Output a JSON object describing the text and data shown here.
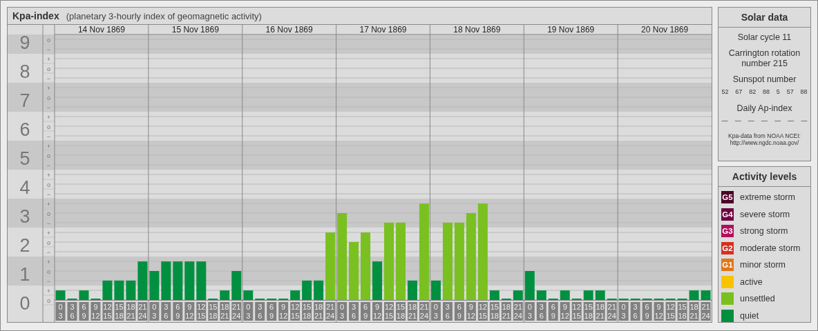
{
  "title": {
    "name": "Kpa-index",
    "subtitle": "(planetary 3-hourly index of geomagnetic activity)"
  },
  "chart": {
    "level_marks": [
      "o",
      "−",
      "+",
      "o",
      "−",
      "+",
      "o",
      "−",
      "+",
      "o",
      "−",
      "+",
      "o",
      "−",
      "+",
      "o",
      "−",
      "+",
      "o",
      "−",
      "+",
      "o",
      "−",
      "+",
      "o",
      "−",
      "+",
      "o"
    ],
    "days": [
      "14 Nov 1869",
      "15 Nov 1869",
      "16 Nov 1869",
      "17 Nov 1869",
      "18 Nov 1869",
      "19 Nov 1869",
      "20 Nov 1869"
    ],
    "chart_data": {
      "type": "bar",
      "grid": true,
      "ylim": [
        0,
        9
      ],
      "yticks": [
        0,
        1,
        2,
        3,
        4,
        5,
        6,
        7,
        8,
        9
      ],
      "categories": [
        "0 3",
        "3 6",
        "6 9",
        "9 12",
        "12 15",
        "15 18",
        "18 21",
        "21 24",
        "0 3",
        "3 6",
        "6 9",
        "9 12",
        "12 15",
        "15 18",
        "18 21",
        "21 24",
        "0 3",
        "3 6",
        "6 9",
        "9 12",
        "12 15",
        "15 18",
        "18 21",
        "21 24",
        "0 3",
        "3 6",
        "6 9",
        "9 12",
        "12 15",
        "15 18",
        "18 21",
        "21 24",
        "0 3",
        "3 6",
        "6 9",
        "9 12",
        "12 15",
        "15 18",
        "18 21",
        "21 24",
        "0 3",
        "3 6",
        "6 9",
        "9 12",
        "12 15",
        "15 18",
        "18 21",
        "21 24",
        "0 3",
        "3 6",
        "6 9",
        "9 12",
        "12 15",
        "15 18",
        "18 21",
        "21 24"
      ],
      "series": [
        {
          "name": "quiet",
          "color": "#009040",
          "values": [
            0.33,
            0,
            0.33,
            0,
            0.67,
            0.67,
            0.67,
            1.33,
            1,
            1.33,
            1.33,
            1.33,
            1.33,
            0,
            0.33,
            1,
            0.33,
            0,
            0,
            0,
            0.33,
            0.67,
            0.67,
            null,
            null,
            null,
            null,
            1.33,
            null,
            null,
            0.67,
            null,
            0.67,
            null,
            null,
            null,
            null,
            0.33,
            0,
            0.33,
            1,
            0.33,
            0,
            0.33,
            0,
            0.33,
            0.33,
            0,
            0,
            0,
            0,
            0,
            0,
            0,
            0.33,
            0.33
          ]
        },
        {
          "name": "unsettled",
          "color": "#7ac020",
          "values": [
            null,
            null,
            null,
            null,
            null,
            null,
            null,
            null,
            null,
            null,
            null,
            null,
            null,
            null,
            null,
            null,
            null,
            null,
            null,
            null,
            null,
            null,
            null,
            2.33,
            3,
            2,
            2.33,
            null,
            2.67,
            2.67,
            null,
            3.33,
            null,
            2.67,
            2.67,
            3,
            3.33,
            null,
            null,
            null,
            null,
            null,
            null,
            null,
            null,
            null,
            null,
            null,
            null,
            null,
            null,
            null,
            null,
            null,
            null,
            null
          ]
        }
      ]
    }
  },
  "solar": {
    "title": "Solar data",
    "cycle": "Solar cycle 11",
    "rotation": "Carrington rotation number 215",
    "sunspot_label": "Sunspot number",
    "sunspots": [
      "52",
      "67",
      "82",
      "88",
      "5",
      "57",
      "88"
    ],
    "ap_label": "Daily Ap-index",
    "ap_values": [
      "—",
      "—",
      "—",
      "—",
      "—",
      "—",
      "—"
    ],
    "source": "Kpa-data from NOAA NCEI:",
    "source_url": "http://www.ngdc.noaa.gov/"
  },
  "activity": {
    "title": "Activity levels",
    "levels": [
      {
        "badge": "G5",
        "label": "extreme storm",
        "color": "#4c0026"
      },
      {
        "badge": "G4",
        "label": "severe storm",
        "color": "#6e0040"
      },
      {
        "badge": "G3",
        "label": "strong storm",
        "color": "#b0105e"
      },
      {
        "badge": "G2",
        "label": "moderate storm",
        "color": "#d82e1e"
      },
      {
        "badge": "G1",
        "label": "minor storm",
        "color": "#e07818"
      },
      {
        "label": "active",
        "color": "#f8c400"
      }
    ]
  }
}
